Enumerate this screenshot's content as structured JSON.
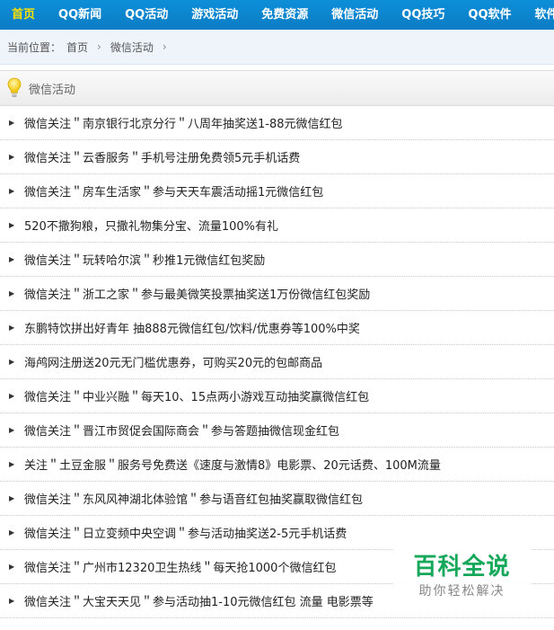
{
  "nav": {
    "items": [
      "首页",
      "QQ新闻",
      "QQ活动",
      "游戏活动",
      "免费资源",
      "微信活动",
      "QQ技巧",
      "QQ软件",
      "软件分类"
    ],
    "active_index": 0,
    "accent_color": "#ffe200",
    "bar_color": "#0d8fd8"
  },
  "breadcrumb": {
    "prefix": "当前位置：",
    "items": [
      "首页",
      "微信活动"
    ]
  },
  "section": {
    "title": "微信活动",
    "icon": "lightbulb-icon"
  },
  "articles": [
    "微信关注＂南京银行北京分行＂八周年抽奖送1-88元微信红包",
    "微信关注＂云香服务＂手机号注册免费领5元手机话费",
    "微信关注＂房车生活家＂参与天天车震活动摇1元微信红包",
    "520不撒狗粮，只撒礼物集分宝、流量100%有礼",
    "微信关注＂玩转哈尔滨＂秒推1元微信红包奖励",
    "微信关注＂浙工之家＂参与最美微笑投票抽奖送1万份微信红包奖励",
    "东鹏特饮拼出好青年 抽888元微信红包/饮料/优惠券等100%中奖",
    "海鸬网注册送20元无门槛优惠券，可购买20元的包邮商品",
    "微信关注＂中业兴融＂每天10、15点两小游戏互动抽奖赢微信红包",
    "微信关注＂晋江市贸促会国际商会＂参与答题抽微信现金红包",
    "关注＂土豆金服＂服务号免费送《速度与激情8》电影票、20元话费、100M流量",
    "微信关注＂东风风神湖北体验馆＂参与语音红包抽奖赢取微信红包",
    "微信关注＂日立变频中央空调＂参与活动抽奖送2-5元手机话费",
    "微信关注＂广州市12320卫生热线＂每天抢1000个微信红包",
    "微信关注＂大宝天天见＂参与活动抽1-10元微信红包 流量 电影票等"
  ],
  "watermark": {
    "main": "百科全说",
    "sub": "助你轻松解决"
  }
}
